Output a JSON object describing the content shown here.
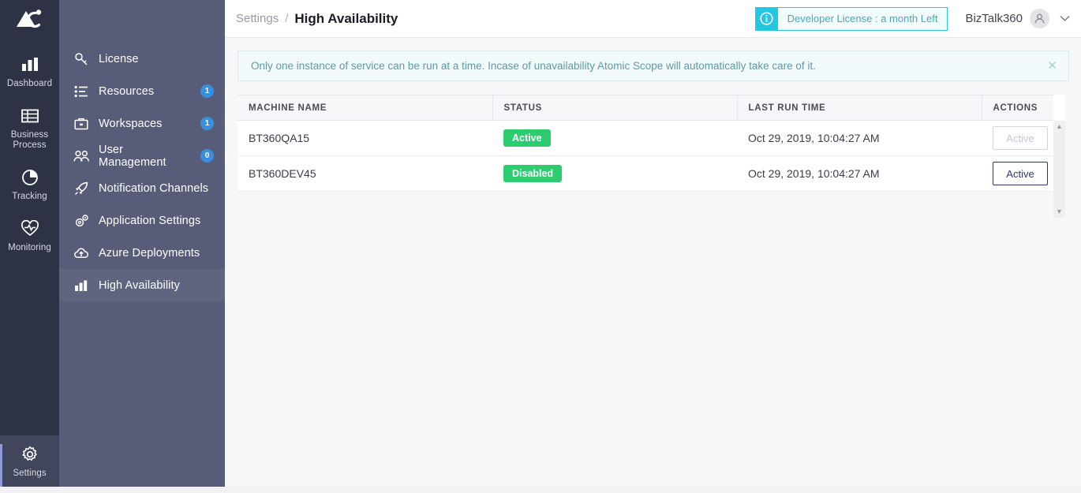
{
  "app": {
    "logo_icon": "atomic-scope-logo-icon"
  },
  "rail": {
    "items": [
      {
        "label": "Dashboard",
        "icon": "bar-chart-icon",
        "active": false
      },
      {
        "label": "Business\nProcess",
        "label_line1": "Business",
        "label_line2": "Process",
        "icon": "table-grid-icon",
        "active": false
      },
      {
        "label": "Tracking",
        "icon": "pie-chart-icon",
        "active": false
      },
      {
        "label": "Monitoring",
        "icon": "heart-pulse-icon",
        "active": false
      }
    ],
    "bottom": {
      "label": "Settings",
      "icon": "gear-icon",
      "active": true
    }
  },
  "sidebar": {
    "items": [
      {
        "label": "License",
        "icon": "key-icon",
        "badge": null,
        "active": false
      },
      {
        "label": "Resources",
        "icon": "list-icon",
        "badge": "1",
        "active": false
      },
      {
        "label": "Workspaces",
        "icon": "briefcase-icon",
        "badge": "1",
        "active": false
      },
      {
        "label": "User Management",
        "icon": "users-icon",
        "badge": "0",
        "active": false
      },
      {
        "label": "Notification Channels",
        "icon": "rocket-icon",
        "badge": null,
        "active": false
      },
      {
        "label": "Application Settings",
        "icon": "gears-icon",
        "badge": null,
        "active": false
      },
      {
        "label": "Azure Deployments",
        "icon": "cloud-upload-icon",
        "badge": null,
        "active": false
      },
      {
        "label": "High Availability",
        "icon": "bar-chart-icon",
        "badge": null,
        "active": true
      }
    ]
  },
  "header": {
    "breadcrumb_parent": "Settings",
    "breadcrumb_separator": "/",
    "breadcrumb_current": "High Availability",
    "license_text": "Developer License : a month Left",
    "license_icon": "info-circle-icon",
    "user_name": "BizTalk360",
    "avatar_icon": "user-avatar-icon",
    "chevron_icon": "chevron-down-icon"
  },
  "notice": {
    "text": "Only one instance of service can be run at a time. Incase of unavailability Atomic Scope will automatically take care of it.",
    "close_icon": "close-icon"
  },
  "table": {
    "columns": [
      "MACHINE NAME",
      "STATUS",
      "LAST RUN TIME",
      "ACTIONS"
    ],
    "rows": [
      {
        "machine_name": "BT360QA15",
        "status": "Active",
        "last_run_time": "Oct 29, 2019, 10:04:27 AM",
        "action_label": "Active",
        "action_enabled": false
      },
      {
        "machine_name": "BT360DEV45",
        "status": "Disabled",
        "last_run_time": "Oct 29, 2019, 10:04:27 AM",
        "action_label": "Active",
        "action_enabled": true
      }
    ],
    "scrollbar": {
      "up_icon": "triangle-up-icon",
      "down_icon": "triangle-down-icon"
    }
  },
  "colors": {
    "rail_bg": "#2e3245",
    "sidebar_bg": "#575d78",
    "sidebar_active": "#5f657f",
    "badge_blue": "#3a8ede",
    "status_green": "#2ecc71",
    "license_cyan": "#21c7e3",
    "notice_bg": "#f2fafb",
    "content_bg": "#f7f7fa",
    "button_navy": "#2f3a63"
  }
}
